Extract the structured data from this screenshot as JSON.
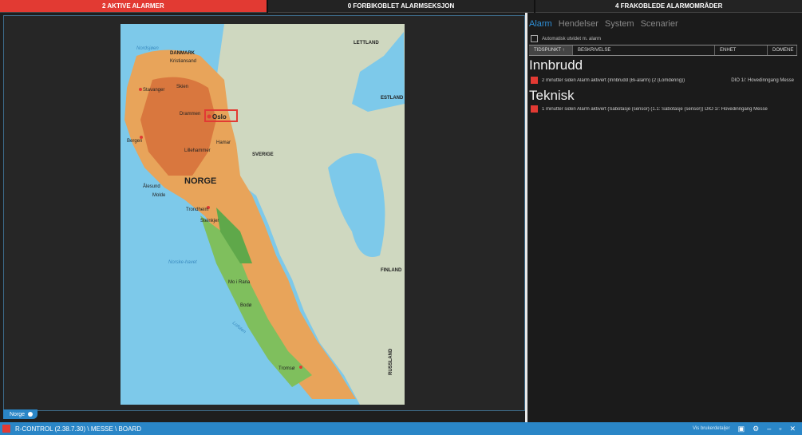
{
  "topbar": {
    "active_alarms": "2 AKTIVE ALARMER",
    "disconnected": "0 FORBIKOBLET ALARMSEKSJON",
    "unarmed_areas": "4 FRAKOBLEDE ALARMOMRÅDER"
  },
  "map": {
    "tab_label": "Norge",
    "cities": [
      "Oslo",
      "Kristiansand",
      "Stavanger",
      "Skien",
      "Drammen",
      "Bergen",
      "Lillehammer",
      "Hamar",
      "Ålesund",
      "Molde",
      "Trondheim",
      "Steinkjer",
      "Mo i Rana",
      "Bodø",
      "Tromsø"
    ],
    "countries": [
      "NORGE",
      "SVERIGE",
      "DANMARK",
      "LETTLAND",
      "ESTLAND",
      "FINLAND",
      "RUSSLAND"
    ],
    "seas": [
      "Norske-havet",
      "Nordsjøen",
      "Lofoten"
    ]
  },
  "right": {
    "tabs": [
      "Alarm",
      "Hendelser",
      "System",
      "Scenarier"
    ],
    "auto_check_label": "Automatisk utvidet m. alarm",
    "columns": [
      "TIDSPUNKT ↑",
      "BESKRIVELSE",
      "ENHET",
      "DOMENE"
    ],
    "groups": [
      {
        "title": "Innbrudd",
        "alarm": "2 minutter siden  Alarm aktivert (Innbrudd (Bi-alarm) (2 (Lomdering))",
        "meta": "DIO 1/: Hovedinngang  Messe"
      },
      {
        "title": "Teknisk",
        "alarm": "1 minutter siden  Alarm aktivert (Sabotasje (sensor) (1.1: Sabotasje (sensor))  DIO 1/: Hovedinngang  Messe",
        "meta": ""
      }
    ]
  },
  "statusbar": {
    "title": "R-CONTROL (2.38.7.30)  \\ MESSE \\ BOARD",
    "user": "Vis brukerdetaljer"
  },
  "colors": {
    "alarm": "#e23a33",
    "accent": "#2a86c7"
  }
}
